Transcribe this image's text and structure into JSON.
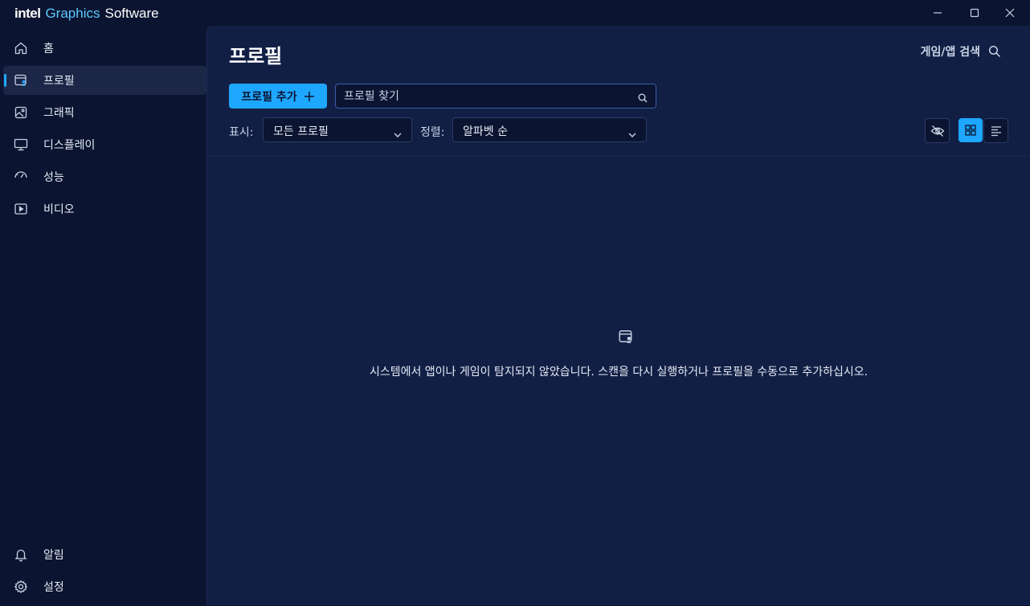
{
  "app": {
    "logo_intel": "intel",
    "logo_graphics": "Graphics",
    "logo_software": "Software"
  },
  "sidebar": {
    "items": [
      {
        "label": "홈",
        "icon": "home-icon"
      },
      {
        "label": "프로필",
        "icon": "profile-icon",
        "active": true
      },
      {
        "label": "그래픽",
        "icon": "image-icon"
      },
      {
        "label": "디스플레이",
        "icon": "monitor-icon"
      },
      {
        "label": "성능",
        "icon": "gauge-icon"
      },
      {
        "label": "비디오",
        "icon": "video-icon"
      }
    ],
    "bottom": [
      {
        "label": "알림",
        "icon": "bell-icon"
      },
      {
        "label": "설정",
        "icon": "gear-icon"
      }
    ]
  },
  "header": {
    "title": "프로필",
    "search_games_label": "게임/앱 검색"
  },
  "toolbar": {
    "add_profile_label": "프로필 추가",
    "find_placeholder": "프로필 찾기",
    "show_label": "표시:",
    "show_value": "모든 프로필",
    "sort_label": "정렬:",
    "sort_value": "알파벳 순"
  },
  "empty_state": {
    "message": "시스템에서 앱이나 게임이 탐지되지 않았습니다. 스캔을 다시 실행하거나 프로필을 수동으로 추가하십시오."
  },
  "colors": {
    "accent": "#1ea7ff",
    "content_bg": "#121f45",
    "sidebar_bg": "#0b1430"
  }
}
